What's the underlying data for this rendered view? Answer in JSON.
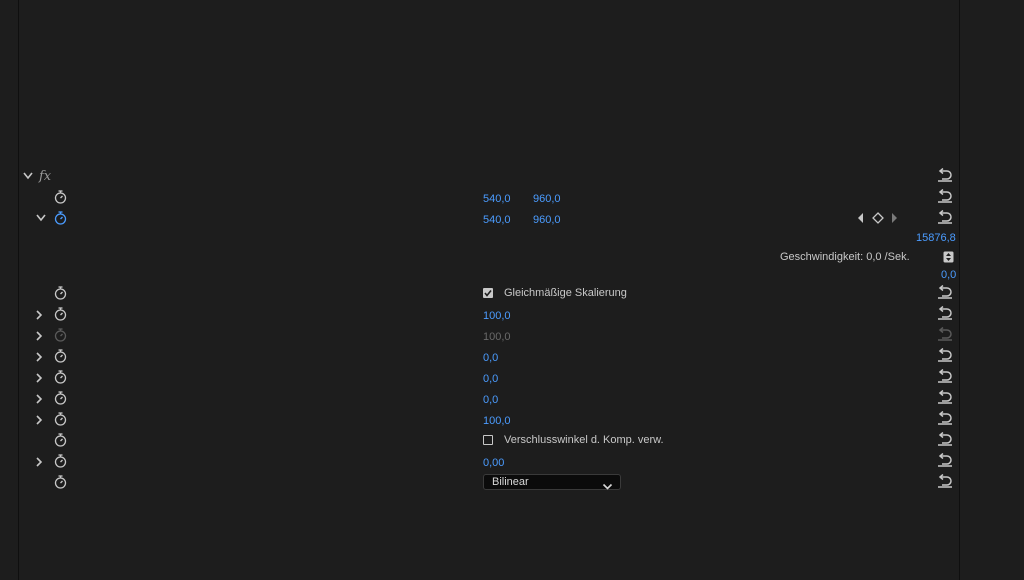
{
  "panel": {
    "fx_label": "fx",
    "speed_label": "Geschwindigkeit: 0,0 /Sek.",
    "speed_max": "15876,8",
    "speed_min": "0,0"
  },
  "rows": [
    {
      "values": [
        "540,0",
        "960,0"
      ]
    },
    {
      "values": [
        "540,0",
        "960,0"
      ]
    },
    {
      "checkbox_label": "Gleichmäßige Skalierung",
      "checked": true
    },
    {
      "value": "100,0"
    },
    {
      "value": "100,0"
    },
    {
      "value": "0,0"
    },
    {
      "value": "0,0"
    },
    {
      "value": "0,0"
    },
    {
      "value": "100,0"
    },
    {
      "checkbox_label": "Verschlusswinkel d. Komp. verw.",
      "checked": false
    },
    {
      "value": "0,00"
    },
    {
      "dropdown_value": "Bilinear"
    }
  ],
  "icons": {
    "chevron_down": "chevron-down-icon",
    "chevron_right": "chevron-right-icon",
    "stopwatch": "stopwatch-icon",
    "reset": "reset-icon",
    "keyframe": "keyframe-diamond-icon"
  },
  "colors": {
    "background": "#1d1d1d",
    "value_blue": "#4b9cff",
    "text": "#c8c8c8",
    "disabled": "#6a6a6a"
  }
}
